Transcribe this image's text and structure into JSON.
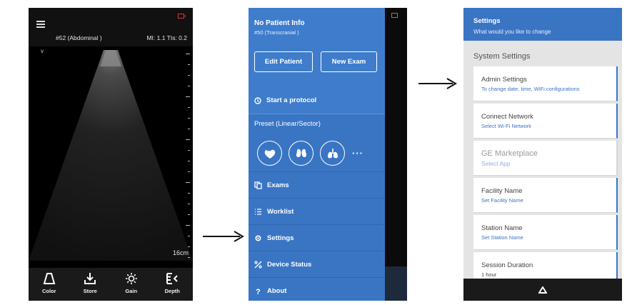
{
  "scan_screen": {
    "preset_label": "#52 (Abdominal )",
    "mi_tis": "MI: 1.1  TIs: 0.2",
    "orientation_marker": "v",
    "depth_readout": "16cm",
    "tools": [
      {
        "label": "Color",
        "icon": "color-icon"
      },
      {
        "label": "Store",
        "icon": "store-icon"
      },
      {
        "label": "Gain",
        "icon": "gain-icon"
      },
      {
        "label": "Depth",
        "icon": "depth-icon"
      }
    ]
  },
  "menu_screen": {
    "patient_title": "No Patient Info",
    "patient_sub": "#50 (Transcranial )",
    "edit_patient": "Edit Patient",
    "new_exam": "New Exam",
    "start_protocol": "Start a protocol",
    "preset_title": "Preset (Linear/Sector)",
    "preset_icons": [
      "heart-icon",
      "kidney-icon",
      "lungs-icon"
    ],
    "more": "···",
    "nav_items": [
      {
        "label": "Exams",
        "icon": "exams-icon"
      },
      {
        "label": "Worklist",
        "icon": "worklist-icon"
      },
      {
        "label": "Settings",
        "icon": "gear-icon"
      },
      {
        "label": "Device Status",
        "icon": "device-status-icon"
      },
      {
        "label": "About",
        "icon": "question-icon"
      }
    ]
  },
  "settings_screen": {
    "title": "Settings",
    "subtitle": "What would you like to change",
    "section": "System Settings",
    "cards": [
      {
        "title": "Admin Settings",
        "sub": "To change date, time, WiFi configurations"
      },
      {
        "title": "Connect Network",
        "sub": "Select Wi-Fi Network"
      },
      {
        "title": "GE Marketplace",
        "sub": "Select App"
      },
      {
        "title": "Facility Name",
        "sub": "Set Facility Name"
      },
      {
        "title": "Station Name",
        "sub": "Set Station Name"
      },
      {
        "title": "Session Duration",
        "sub": "1 hour"
      }
    ]
  },
  "colors": {
    "brand_blue": "#3a75c4",
    "battery_red": "#e0303a"
  }
}
